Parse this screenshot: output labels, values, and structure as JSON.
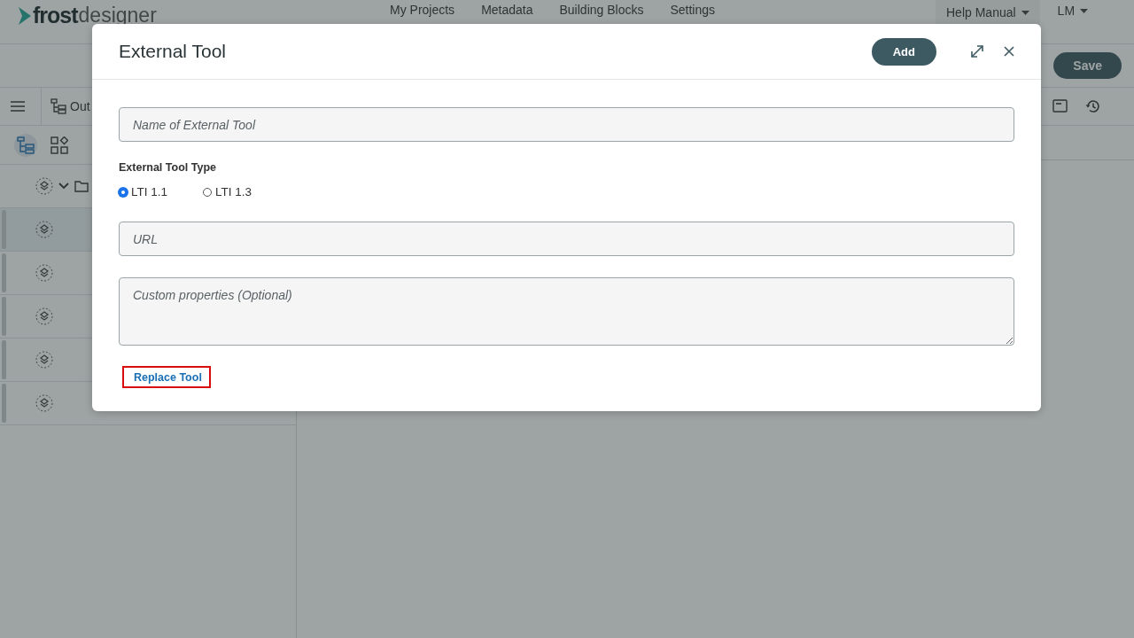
{
  "app": {
    "logo": {
      "brand": "frost",
      "product": "designer"
    },
    "nav": [
      "My Projects",
      "Metadata",
      "Building Blocks",
      "Settings"
    ],
    "help_menu": "Help Manual",
    "user_menu": "LM",
    "save_button": "Save",
    "outline_tab": "Out",
    "view_modes": [
      {
        "selected": true
      },
      {
        "selected": false
      }
    ],
    "tree_rows": [
      {
        "kind": "folder",
        "selected": false
      },
      {
        "kind": "item",
        "selected": true
      },
      {
        "kind": "item",
        "selected": false
      },
      {
        "kind": "item",
        "selected": false
      },
      {
        "kind": "item",
        "selected": false
      },
      {
        "kind": "item",
        "selected": false
      }
    ]
  },
  "modal": {
    "title": "External Tool",
    "add_button": "Add",
    "name_field": {
      "placeholder": "Name of External Tool"
    },
    "type_label": "External Tool Type",
    "types": [
      {
        "label": "LTI 1.1",
        "selected": true
      },
      {
        "label": "LTI 1.3",
        "selected": false
      }
    ],
    "url_field": {
      "placeholder": "URL"
    },
    "custom_field": {
      "placeholder": "Custom properties (Optional)"
    },
    "replace_link": "Replace Tool"
  }
}
